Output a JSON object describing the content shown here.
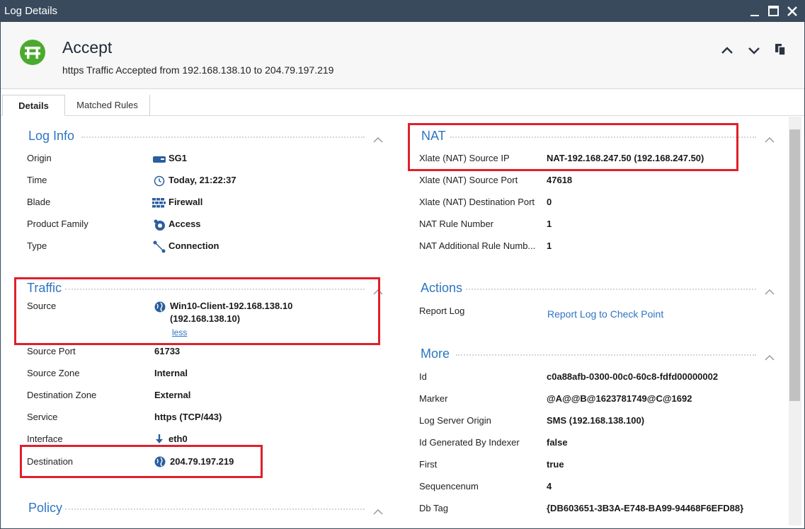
{
  "window": {
    "title": "Log Details"
  },
  "header": {
    "title": "Accept",
    "subtitle": "https Traffic Accepted from 192.168.138.10 to 204.79.197.219"
  },
  "tabs": [
    {
      "label": "Details"
    },
    {
      "label": "Matched Rules"
    }
  ],
  "log_info": {
    "title": "Log Info",
    "rows": [
      {
        "label": "Origin",
        "value": "SG1",
        "icon": "gateway-icon"
      },
      {
        "label": "Time",
        "value": "Today, 21:22:37",
        "icon": "clock-icon"
      },
      {
        "label": "Blade",
        "value": "Firewall",
        "icon": "firewall-icon"
      },
      {
        "label": "Product Family",
        "value": "Access",
        "icon": "access-icon"
      },
      {
        "label": "Type",
        "value": "Connection",
        "icon": "connection-icon"
      }
    ]
  },
  "traffic": {
    "title": "Traffic",
    "source_label": "Source",
    "source_value_line1": "Win10-Client-192.168.138.10",
    "source_value_line2": "(192.168.138.10)",
    "less_link": "less",
    "rows": [
      {
        "label": "Source Port",
        "value": "61733"
      },
      {
        "label": "Source Zone",
        "value": "Internal"
      },
      {
        "label": "Destination Zone",
        "value": "External"
      },
      {
        "label": "Service",
        "value": "https (TCP/443)"
      },
      {
        "label": "Interface",
        "value": "eth0",
        "icon": "arrow-down-icon"
      }
    ],
    "destination_label": "Destination",
    "destination_value": "204.79.197.219"
  },
  "policy": {
    "title": "Policy"
  },
  "nat": {
    "title": "NAT",
    "rows": [
      {
        "label": "Xlate (NAT) Source IP",
        "value": "NAT-192.168.247.50 (192.168.247.50)"
      },
      {
        "label": "Xlate (NAT) Source Port",
        "value": "47618"
      },
      {
        "label": "Xlate (NAT) Destination Port",
        "value": "0"
      },
      {
        "label": "NAT Rule Number",
        "value": "1"
      },
      {
        "label": "NAT Additional Rule Numb...",
        "value": "1"
      }
    ]
  },
  "actions": {
    "title": "Actions",
    "report_label": "Report Log",
    "report_link": "Report Log to Check Point"
  },
  "more": {
    "title": "More",
    "rows": [
      {
        "label": "Id",
        "value": "c0a88afb-0300-00c0-60c8-fdfd00000002"
      },
      {
        "label": "Marker",
        "value": "@A@@B@1623781749@C@1692"
      },
      {
        "label": "Log Server Origin",
        "value": "SMS (192.168.138.100)"
      },
      {
        "label": "Id Generated By Indexer",
        "value": "false"
      },
      {
        "label": "First",
        "value": "true"
      },
      {
        "label": "Sequencenum",
        "value": "4"
      },
      {
        "label": "Db Tag",
        "value": "{DB603651-3B3A-E748-BA99-94468F6EFD88}"
      }
    ]
  },
  "colors": {
    "accent": "#2d75c2",
    "accept_green": "#4aaa2e",
    "highlight_red": "#e0202a",
    "titlebar": "#3a4a5d"
  }
}
